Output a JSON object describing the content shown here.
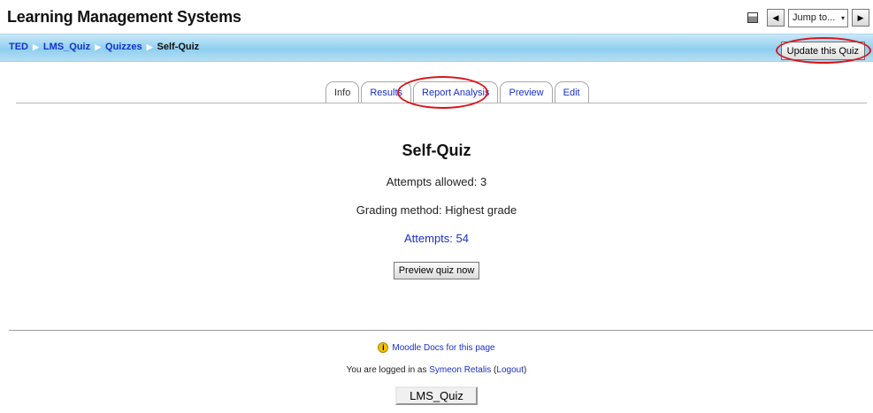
{
  "header": {
    "site_title": "Learning Management Systems",
    "doc_icon": "document-icon",
    "prev_icon": "◀",
    "next_icon": "▶",
    "jump_label": "Jump to...",
    "jump_arrow": "▾"
  },
  "breadcrumb": {
    "items": [
      "TED",
      "LMS_Quiz",
      "Quizzes"
    ],
    "current": "Self-Quiz",
    "separator": "▶"
  },
  "update_button": "Update this Quiz",
  "tabs": [
    "Info",
    "Results",
    "Report Analysis",
    "Preview",
    "Edit"
  ],
  "main": {
    "title": "Self-Quiz",
    "attempts_allowed": "Attempts allowed: 3",
    "grading_method": "Grading method: Highest grade",
    "attempts_link": "Attempts: 54",
    "preview_button": "Preview quiz now"
  },
  "footer": {
    "help_icon": "i",
    "docs_link": "Moodle Docs for this page",
    "logged_in_prefix": "You are logged in as ",
    "user_name": "Symeon Retalis",
    "logout_open": " (",
    "logout_link": "Logout",
    "logout_close": ")",
    "course_button": "LMS_Quiz"
  },
  "colors": {
    "link": "#1a2fc8",
    "breadcrumb_bar": "#8ecfef",
    "highlight_ring": "#d8161c"
  }
}
